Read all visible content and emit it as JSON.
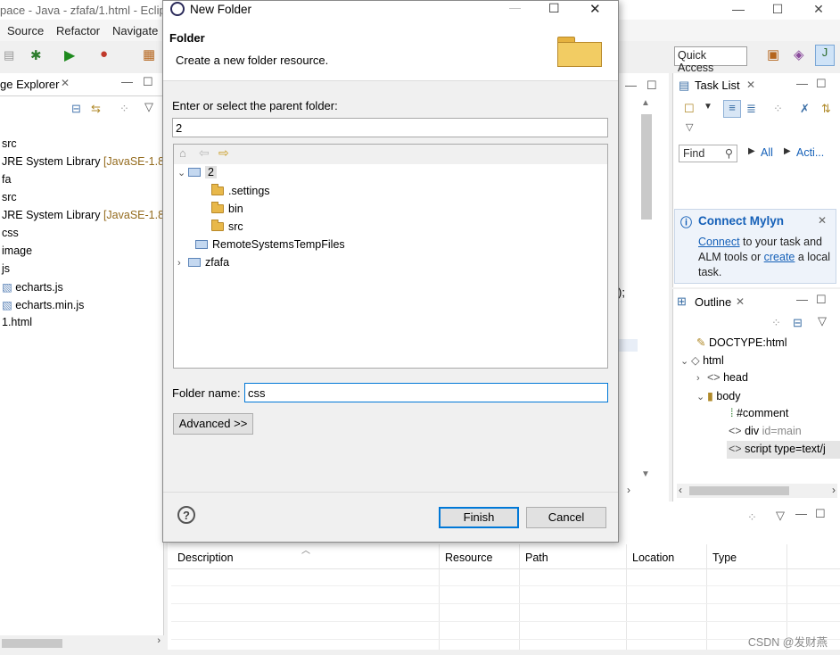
{
  "eclipse": {
    "title": "pace - Java - zfafa/1.html - Eclip",
    "menu": [
      "Source",
      "Refactor",
      "Navigate"
    ],
    "quick_access": "Quick Access",
    "package_explorer": {
      "tab_title": "ge Explorer",
      "items": [
        {
          "label": "src",
          "decoration": ""
        },
        {
          "label": "JRE System Library",
          "decoration": "[JavaSE-1.8]"
        },
        {
          "label": "fa",
          "decoration": ""
        },
        {
          "label": "src",
          "decoration": ""
        },
        {
          "label": "JRE System Library",
          "decoration": "[JavaSE-1.8]"
        },
        {
          "label": "css",
          "decoration": ""
        },
        {
          "label": "image",
          "decoration": ""
        },
        {
          "label": "js",
          "decoration": ""
        },
        {
          "label": "echarts.js",
          "decoration": ""
        },
        {
          "label": "echarts.min.js",
          "decoration": ""
        },
        {
          "label": "1.html",
          "decoration": ""
        }
      ]
    },
    "editor_fragment": ");",
    "task_list": {
      "title": "Task List",
      "find_placeholder": "Find",
      "all_label": "All",
      "acti_label": "Acti..."
    },
    "mylyn": {
      "title": "Connect Mylyn",
      "connect_link": "Connect",
      "text1": " to your task and ALM tools or ",
      "create_link": "create",
      "text2": " a local task."
    },
    "outline": {
      "title": "Outline",
      "items": [
        {
          "label": "DOCTYPE:html",
          "attr": ""
        },
        {
          "label": "html",
          "attr": ""
        },
        {
          "label": "head",
          "attr": ""
        },
        {
          "label": "body",
          "attr": ""
        },
        {
          "label": "#comment",
          "attr": ""
        },
        {
          "label": "div",
          "attr": "id=main"
        },
        {
          "label": "script type=text/j",
          "attr": ""
        }
      ]
    },
    "problems": {
      "columns": [
        "Description",
        "Resource",
        "Path",
        "Location",
        "Type"
      ]
    },
    "watermark": "CSDN @发财燕"
  },
  "dialog": {
    "title": "New Folder",
    "header_title": "Folder",
    "header_subtitle": "Create a new folder resource.",
    "parent_label": "Enter or select the parent folder:",
    "parent_value": "2",
    "tree": [
      {
        "label": "2",
        "level": 0,
        "expanded": true,
        "type": "project"
      },
      {
        "label": ".settings",
        "level": 1,
        "type": "folder"
      },
      {
        "label": "bin",
        "level": 1,
        "type": "folder"
      },
      {
        "label": "src",
        "level": 1,
        "type": "folder"
      },
      {
        "label": "RemoteSystemsTempFiles",
        "level": 0,
        "type": "project"
      },
      {
        "label": "zfafa",
        "level": 0,
        "expanded": false,
        "type": "project"
      }
    ],
    "folder_name_label": "Folder name:",
    "folder_name_value": "css",
    "advanced_label": "Advanced >>",
    "finish_label": "Finish",
    "cancel_label": "Cancel"
  }
}
